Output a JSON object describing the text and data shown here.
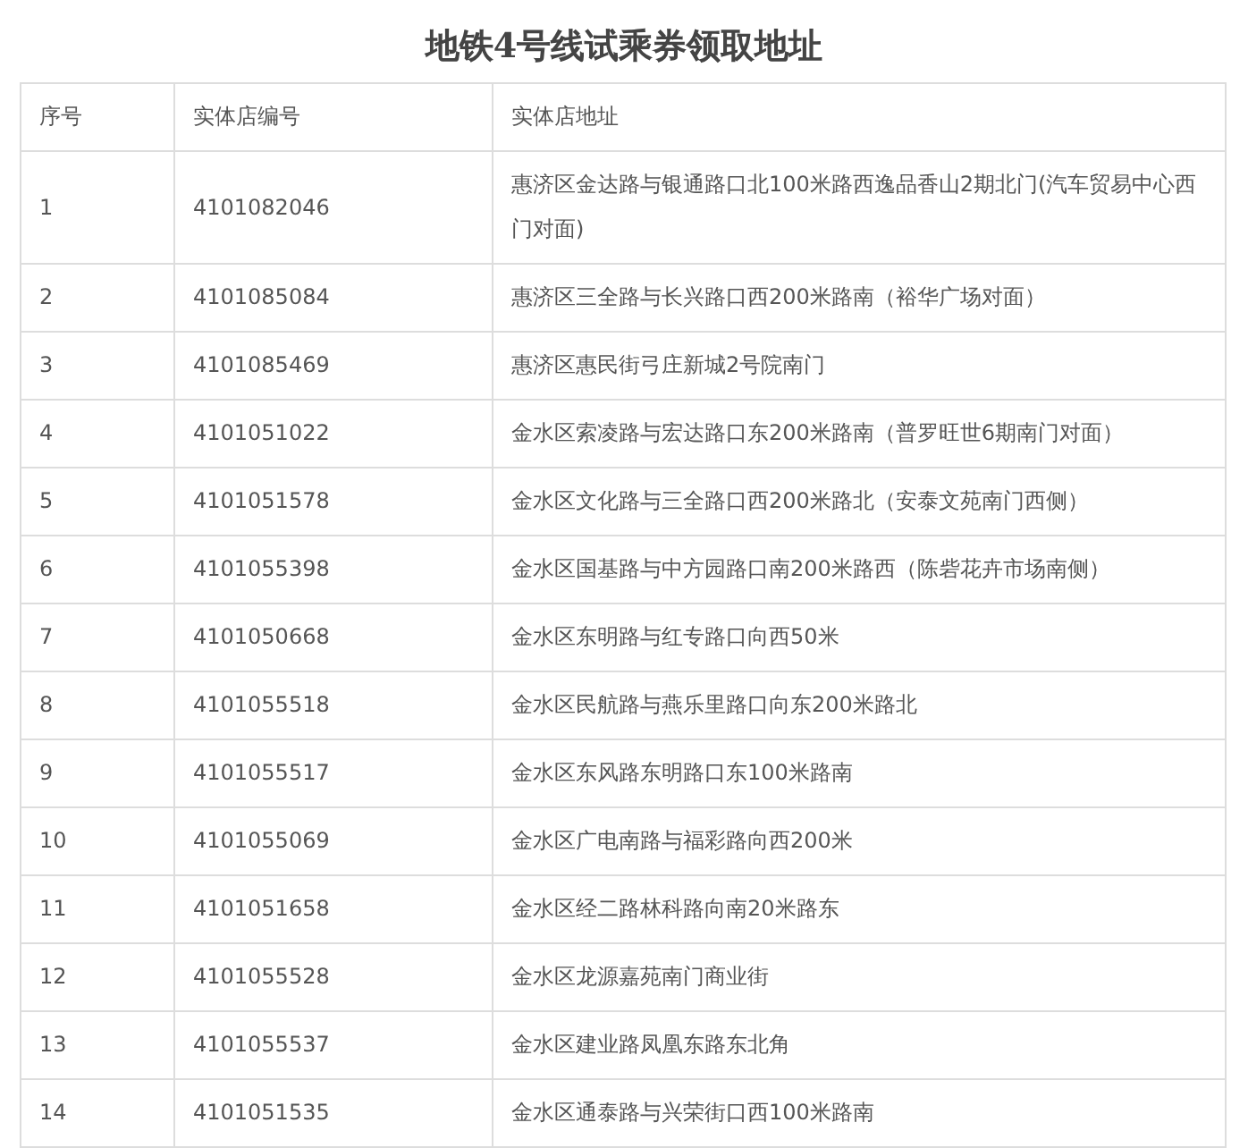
{
  "title": "地铁4号线试乘券领取地址",
  "table": {
    "columns": [
      "序号",
      "实体店编号",
      "实体店地址"
    ],
    "rows": [
      [
        "1",
        "4101082046",
        "惠济区金达路与银通路口北100米路西逸品香山2期北门(汽车贸易中心西门对面)"
      ],
      [
        "2",
        "4101085084",
        "惠济区三全路与长兴路口西200米路南（裕华广场对面）"
      ],
      [
        "3",
        "4101085469",
        "惠济区惠民街弓庄新城2号院南门"
      ],
      [
        "4",
        "4101051022",
        "金水区索凌路与宏达路口东200米路南（普罗旺世6期南门对面）"
      ],
      [
        "5",
        "4101051578",
        "金水区文化路与三全路口西200米路北（安泰文苑南门西侧）"
      ],
      [
        "6",
        "4101055398",
        "金水区国基路与中方园路口南200米路西（陈砦花卉市场南侧）"
      ],
      [
        "7",
        "4101050668",
        "金水区东明路与红专路口向西50米"
      ],
      [
        "8",
        "4101055518",
        "金水区民航路与燕乐里路口向东200米路北"
      ],
      [
        "9",
        "4101055517",
        "金水区东风路东明路口东100米路南"
      ],
      [
        "10",
        "4101055069",
        "金水区广电南路与福彩路向西200米"
      ],
      [
        "11",
        "4101051658",
        "金水区经二路林科路向南20米路东"
      ],
      [
        "12",
        "4101055528",
        "金水区龙源嘉苑南门商业街"
      ],
      [
        "13",
        "4101055537",
        "金水区建业路凤凰东路东北角"
      ],
      [
        "14",
        "4101051535",
        "金水区通泰路与兴荣街口西100米路南"
      ]
    ]
  }
}
